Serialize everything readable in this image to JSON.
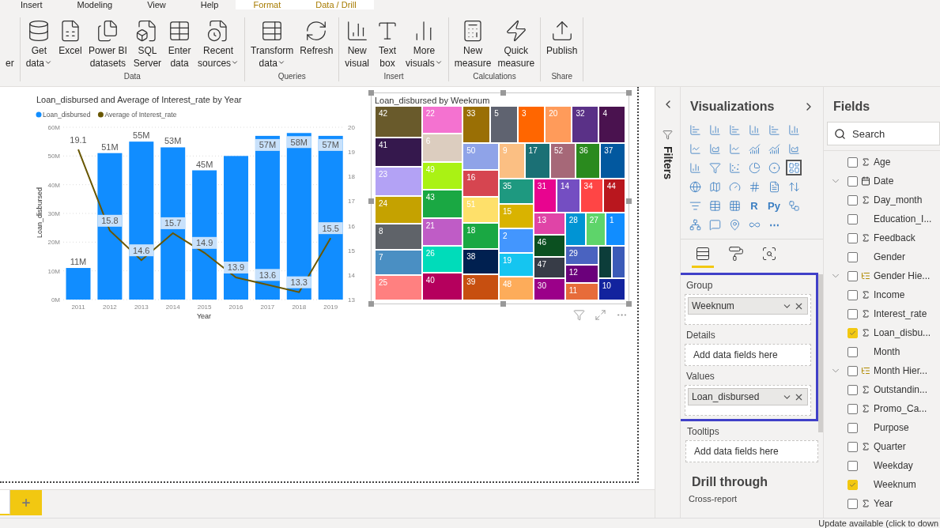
{
  "ribbon_tabs": [
    {
      "label": "Insert",
      "contextual": false
    },
    {
      "label": "Modeling",
      "contextual": false
    },
    {
      "label": "View",
      "contextual": false
    },
    {
      "label": "Help",
      "contextual": false
    },
    {
      "label": "Format",
      "contextual": true
    },
    {
      "label": "Data / Drill",
      "contextual": true
    }
  ],
  "ribbon_groups": [
    {
      "buttons": [
        {
          "label": "er",
          "dropdown": false
        }
      ]
    },
    {
      "label": "Data",
      "buttons": [
        {
          "label": "Get\ndata",
          "dropdown": true
        },
        {
          "label": "Excel",
          "dropdown": false
        },
        {
          "label": "Power BI\ndatasets",
          "dropdown": false
        },
        {
          "label": "SQL\nServer",
          "dropdown": false
        },
        {
          "label": "Enter\ndata",
          "dropdown": false
        },
        {
          "label": "Recent\nsources",
          "dropdown": true
        }
      ]
    },
    {
      "label": "Queries",
      "buttons": [
        {
          "label": "Transform\ndata",
          "dropdown": true
        },
        {
          "label": "Refresh",
          "dropdown": false
        }
      ]
    },
    {
      "label": "Insert",
      "buttons": [
        {
          "label": "New\nvisual",
          "dropdown": false
        },
        {
          "label": "Text\nbox",
          "dropdown": false
        },
        {
          "label": "More\nvisuals",
          "dropdown": true
        }
      ]
    },
    {
      "label": "Calculations",
      "buttons": [
        {
          "label": "New\nmeasure",
          "dropdown": false
        },
        {
          "label": "Quick\nmeasure",
          "dropdown": false
        }
      ]
    },
    {
      "label": "Share",
      "buttons": [
        {
          "label": "Publish",
          "dropdown": false
        }
      ]
    }
  ],
  "combo": {
    "chart_data": {
      "type": "bar",
      "title": "Loan_disbursed and Average of Interest_rate by Year",
      "xlabel": "Year",
      "ylabel": "Loan_disbursed",
      "categories": [
        "2011",
        "2012",
        "2013",
        "2014",
        "2015",
        "2016",
        "2017",
        "2018",
        "2019"
      ],
      "series": [
        {
          "name": "Loan_disbursed",
          "color": "#118dff",
          "type": "bar",
          "values": [
            11,
            51,
            55,
            53,
            45,
            50,
            57,
            58,
            57
          ],
          "value_labels": [
            "11M",
            "51M",
            "55M",
            "53M",
            "45M",
            null,
            "57M",
            "58M",
            "57M"
          ]
        },
        {
          "name": "Average of Interest_rate",
          "color": "#685600",
          "type": "line",
          "axis": "y2",
          "values": [
            19.1,
            15.8,
            14.6,
            15.7,
            14.9,
            13.9,
            13.6,
            13.3,
            15.5
          ],
          "value_labels": [
            "19.1",
            "15.8",
            "14.6",
            "15.7",
            "14.9",
            "13.9",
            "13.6",
            "13.3",
            "15.5"
          ]
        }
      ],
      "ylim": [
        0,
        60
      ],
      "yticks": [
        {
          "value": 0,
          "label": "0M"
        },
        {
          "value": 10,
          "label": "10M"
        },
        {
          "value": 20,
          "label": "20M"
        },
        {
          "value": 30,
          "label": "30M"
        },
        {
          "value": 40,
          "label": "40M"
        },
        {
          "value": 50,
          "label": "50M"
        },
        {
          "value": 60,
          "label": "60M"
        }
      ],
      "y2lim": [
        13,
        20
      ],
      "y2ticks": [
        13,
        14,
        15,
        16,
        17,
        18,
        19,
        20
      ],
      "data_labels": true,
      "grid": true,
      "legend": "top-left"
    }
  },
  "treemap": {
    "title": "Loan_disbursed by Weeknum",
    "tiles": [
      {
        "label": "42",
        "color": "#695a2b"
      },
      {
        "label": "41",
        "color": "#35184d"
      },
      {
        "label": "23",
        "color": "#b3a2f5"
      },
      {
        "label": "24",
        "color": "#c5a200"
      },
      {
        "label": "8",
        "color": "#5f6369"
      },
      {
        "label": "7",
        "color": "#4a8fc3"
      },
      {
        "label": "25",
        "color": "#ff8080"
      },
      {
        "label": "22",
        "color": "#f472d0"
      },
      {
        "label": "6",
        "color": "#dccdbf"
      },
      {
        "label": "49",
        "color": "#aaf214"
      },
      {
        "label": "43",
        "color": "#1aa843"
      },
      {
        "label": "21",
        "color": "#bf5cc6"
      },
      {
        "label": "26",
        "color": "#00dcba"
      },
      {
        "label": "40",
        "color": "#b5005d"
      },
      {
        "label": "33",
        "color": "#9a6f05"
      },
      {
        "label": "5",
        "color": "#5f6370"
      },
      {
        "label": "3",
        "color": "#ff6600"
      },
      {
        "label": "20",
        "color": "#ff9b5a"
      },
      {
        "label": "32",
        "color": "#5a3187"
      },
      {
        "label": "4",
        "color": "#4a124f"
      },
      {
        "label": "50",
        "color": "#8fa3e8"
      },
      {
        "label": "16",
        "color": "#d64550"
      },
      {
        "label": "51",
        "color": "#fee06a"
      },
      {
        "label": "18",
        "color": "#1aa843"
      },
      {
        "label": "38",
        "color": "#002050"
      },
      {
        "label": "39",
        "color": "#c74f10"
      },
      {
        "label": "9",
        "color": "#fbbf83"
      },
      {
        "label": "17",
        "color": "#1b7075"
      },
      {
        "label": "52",
        "color": "#a66878"
      },
      {
        "label": "36",
        "color": "#2a8a1e"
      },
      {
        "label": "37",
        "color": "#02589f"
      },
      {
        "label": "35",
        "color": "#1e9980"
      },
      {
        "label": "15",
        "color": "#d9b300"
      },
      {
        "label": "2",
        "color": "#4396fe"
      },
      {
        "label": "19",
        "color": "#15c5f0"
      },
      {
        "label": "48",
        "color": "#fdac5a"
      },
      {
        "label": "31",
        "color": "#e8048f"
      },
      {
        "label": "14",
        "color": "#744ec2"
      },
      {
        "label": "34",
        "color": "#ff4545"
      },
      {
        "label": "44",
        "color": "#b9171e"
      },
      {
        "label": "13",
        "color": "#e044a7"
      },
      {
        "label": "46",
        "color": "#0b5020"
      },
      {
        "label": "47",
        "color": "#373c47"
      },
      {
        "label": "30",
        "color": "#9b0089"
      },
      {
        "label": "28",
        "color": "#0094d4"
      },
      {
        "label": "27",
        "color": "#5ed46a"
      },
      {
        "label": "1",
        "color": "#118dff"
      },
      {
        "label": "29",
        "color": "#4a63c0"
      },
      {
        "label": "12",
        "color": "#6b007b"
      },
      {
        "label": "11",
        "color": "#e76c3a"
      },
      {
        "color": "#0c3d3a"
      },
      {
        "color": "#3b5bb8"
      },
      {
        "label": "10",
        "color": "#12239e"
      }
    ]
  },
  "page_tabs": [
    {
      "selected": true
    }
  ],
  "filters_pane": {
    "title": "Filters"
  },
  "visualizations": {
    "title": "Visualizations",
    "types": [
      {
        "selected": false
      },
      {
        "selected": false
      },
      {
        "selected": false
      },
      {
        "selected": false
      },
      {
        "selected": false
      },
      {
        "selected": false
      },
      {
        "selected": false
      },
      {
        "selected": false
      },
      {
        "selected": false
      },
      {
        "selected": false
      },
      {
        "selected": false
      },
      {
        "selected": false
      },
      {
        "selected": false
      },
      {
        "selected": false
      },
      {
        "selected": false
      },
      {
        "selected": false
      },
      {
        "selected": false
      },
      {
        "selected": true
      },
      {
        "selected": false
      },
      {
        "selected": false
      },
      {
        "selected": false
      },
      {
        "selected": false
      },
      {
        "selected": false
      },
      {
        "selected": false
      },
      {
        "selected": false
      },
      {
        "selected": false
      },
      {
        "selected": false
      },
      {
        "selected": false,
        "label": "R"
      },
      {
        "selected": false,
        "label": "Py"
      },
      {
        "selected": false
      },
      {
        "selected": false
      },
      {
        "selected": false
      },
      {
        "selected": false
      },
      {
        "selected": false
      },
      {
        "selected": false,
        "label": "⋯"
      }
    ],
    "pane_tabs": [
      {
        "selected": true
      },
      {
        "selected": false
      },
      {
        "selected": false
      }
    ],
    "wells": [
      {
        "label": "Group",
        "value": "Weeknum",
        "highlighted": true
      },
      {
        "label": "Details",
        "placeholder": "Add data fields here",
        "highlighted": true
      },
      {
        "label": "Values",
        "value": "Loan_disbursed",
        "highlighted": true
      },
      {
        "label": "Tooltips",
        "placeholder": "Add data fields here",
        "highlighted": false
      }
    ],
    "drill_through": {
      "title": "Drill through",
      "label": "Cross-report"
    }
  },
  "fields": {
    "title": "Fields",
    "search": {
      "placeholder": "Search"
    },
    "items": [
      {
        "name": "Age",
        "checked": false,
        "kind": "sigma",
        "expandable": false
      },
      {
        "name": "Date",
        "checked": false,
        "kind": "date",
        "expandable": true
      },
      {
        "name": "Day_month",
        "checked": false,
        "kind": "sigma",
        "expandable": false
      },
      {
        "name": "Education_I...",
        "checked": false,
        "kind": "plain",
        "expandable": false
      },
      {
        "name": "Feedback",
        "checked": false,
        "kind": "sigma",
        "expandable": false
      },
      {
        "name": "Gender",
        "checked": false,
        "kind": "plain",
        "expandable": false
      },
      {
        "name": "Gender Hie...",
        "checked": false,
        "kind": "hierarchy",
        "expandable": true
      },
      {
        "name": "Income",
        "checked": false,
        "kind": "sigma",
        "expandable": false
      },
      {
        "name": "Interest_rate",
        "checked": false,
        "kind": "sigma",
        "expandable": false
      },
      {
        "name": "Loan_disbu...",
        "checked": true,
        "kind": "sigma",
        "expandable": false
      },
      {
        "name": "Month",
        "checked": false,
        "kind": "plain",
        "expandable": false
      },
      {
        "name": "Month Hier...",
        "checked": false,
        "kind": "hierarchy",
        "expandable": true
      },
      {
        "name": "Outstandin...",
        "checked": false,
        "kind": "sigma",
        "expandable": false
      },
      {
        "name": "Promo_Ca...",
        "checked": false,
        "kind": "sigma",
        "expandable": false
      },
      {
        "name": "Purpose",
        "checked": false,
        "kind": "plain",
        "expandable": false
      },
      {
        "name": "Quarter",
        "checked": false,
        "kind": "sigma",
        "expandable": false
      },
      {
        "name": "Weekday",
        "checked": false,
        "kind": "plain",
        "expandable": false
      },
      {
        "name": "Weeknum",
        "checked": true,
        "kind": "plain",
        "expandable": false
      },
      {
        "name": "Year",
        "checked": false,
        "kind": "sigma",
        "expandable": false
      }
    ]
  },
  "status_bar": {
    "text": "Update available (click to down"
  }
}
